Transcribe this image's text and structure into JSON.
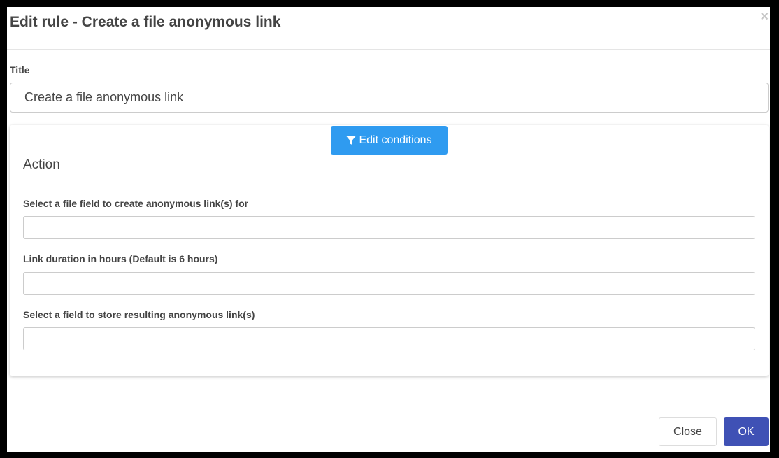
{
  "dialog": {
    "title": "Edit rule - Create a file anonymous link",
    "close_icon": "×"
  },
  "title_field": {
    "label": "Title",
    "value": "Create a file anonymous link"
  },
  "conditions": {
    "button_label": "Edit conditions",
    "icon": "filter-icon"
  },
  "action": {
    "heading": "Action",
    "fields": [
      {
        "label": "Select a file field to create anonymous link(s) for",
        "value": ""
      },
      {
        "label": "Link duration in hours (Default is 6 hours)",
        "value": ""
      },
      {
        "label": "Select a field to store resulting anonymous link(s)",
        "value": ""
      }
    ]
  },
  "footer": {
    "close_label": "Close",
    "ok_label": "OK"
  },
  "colors": {
    "primary_blue": "#2f9bf0",
    "ok_indigo": "#3f51b5"
  }
}
